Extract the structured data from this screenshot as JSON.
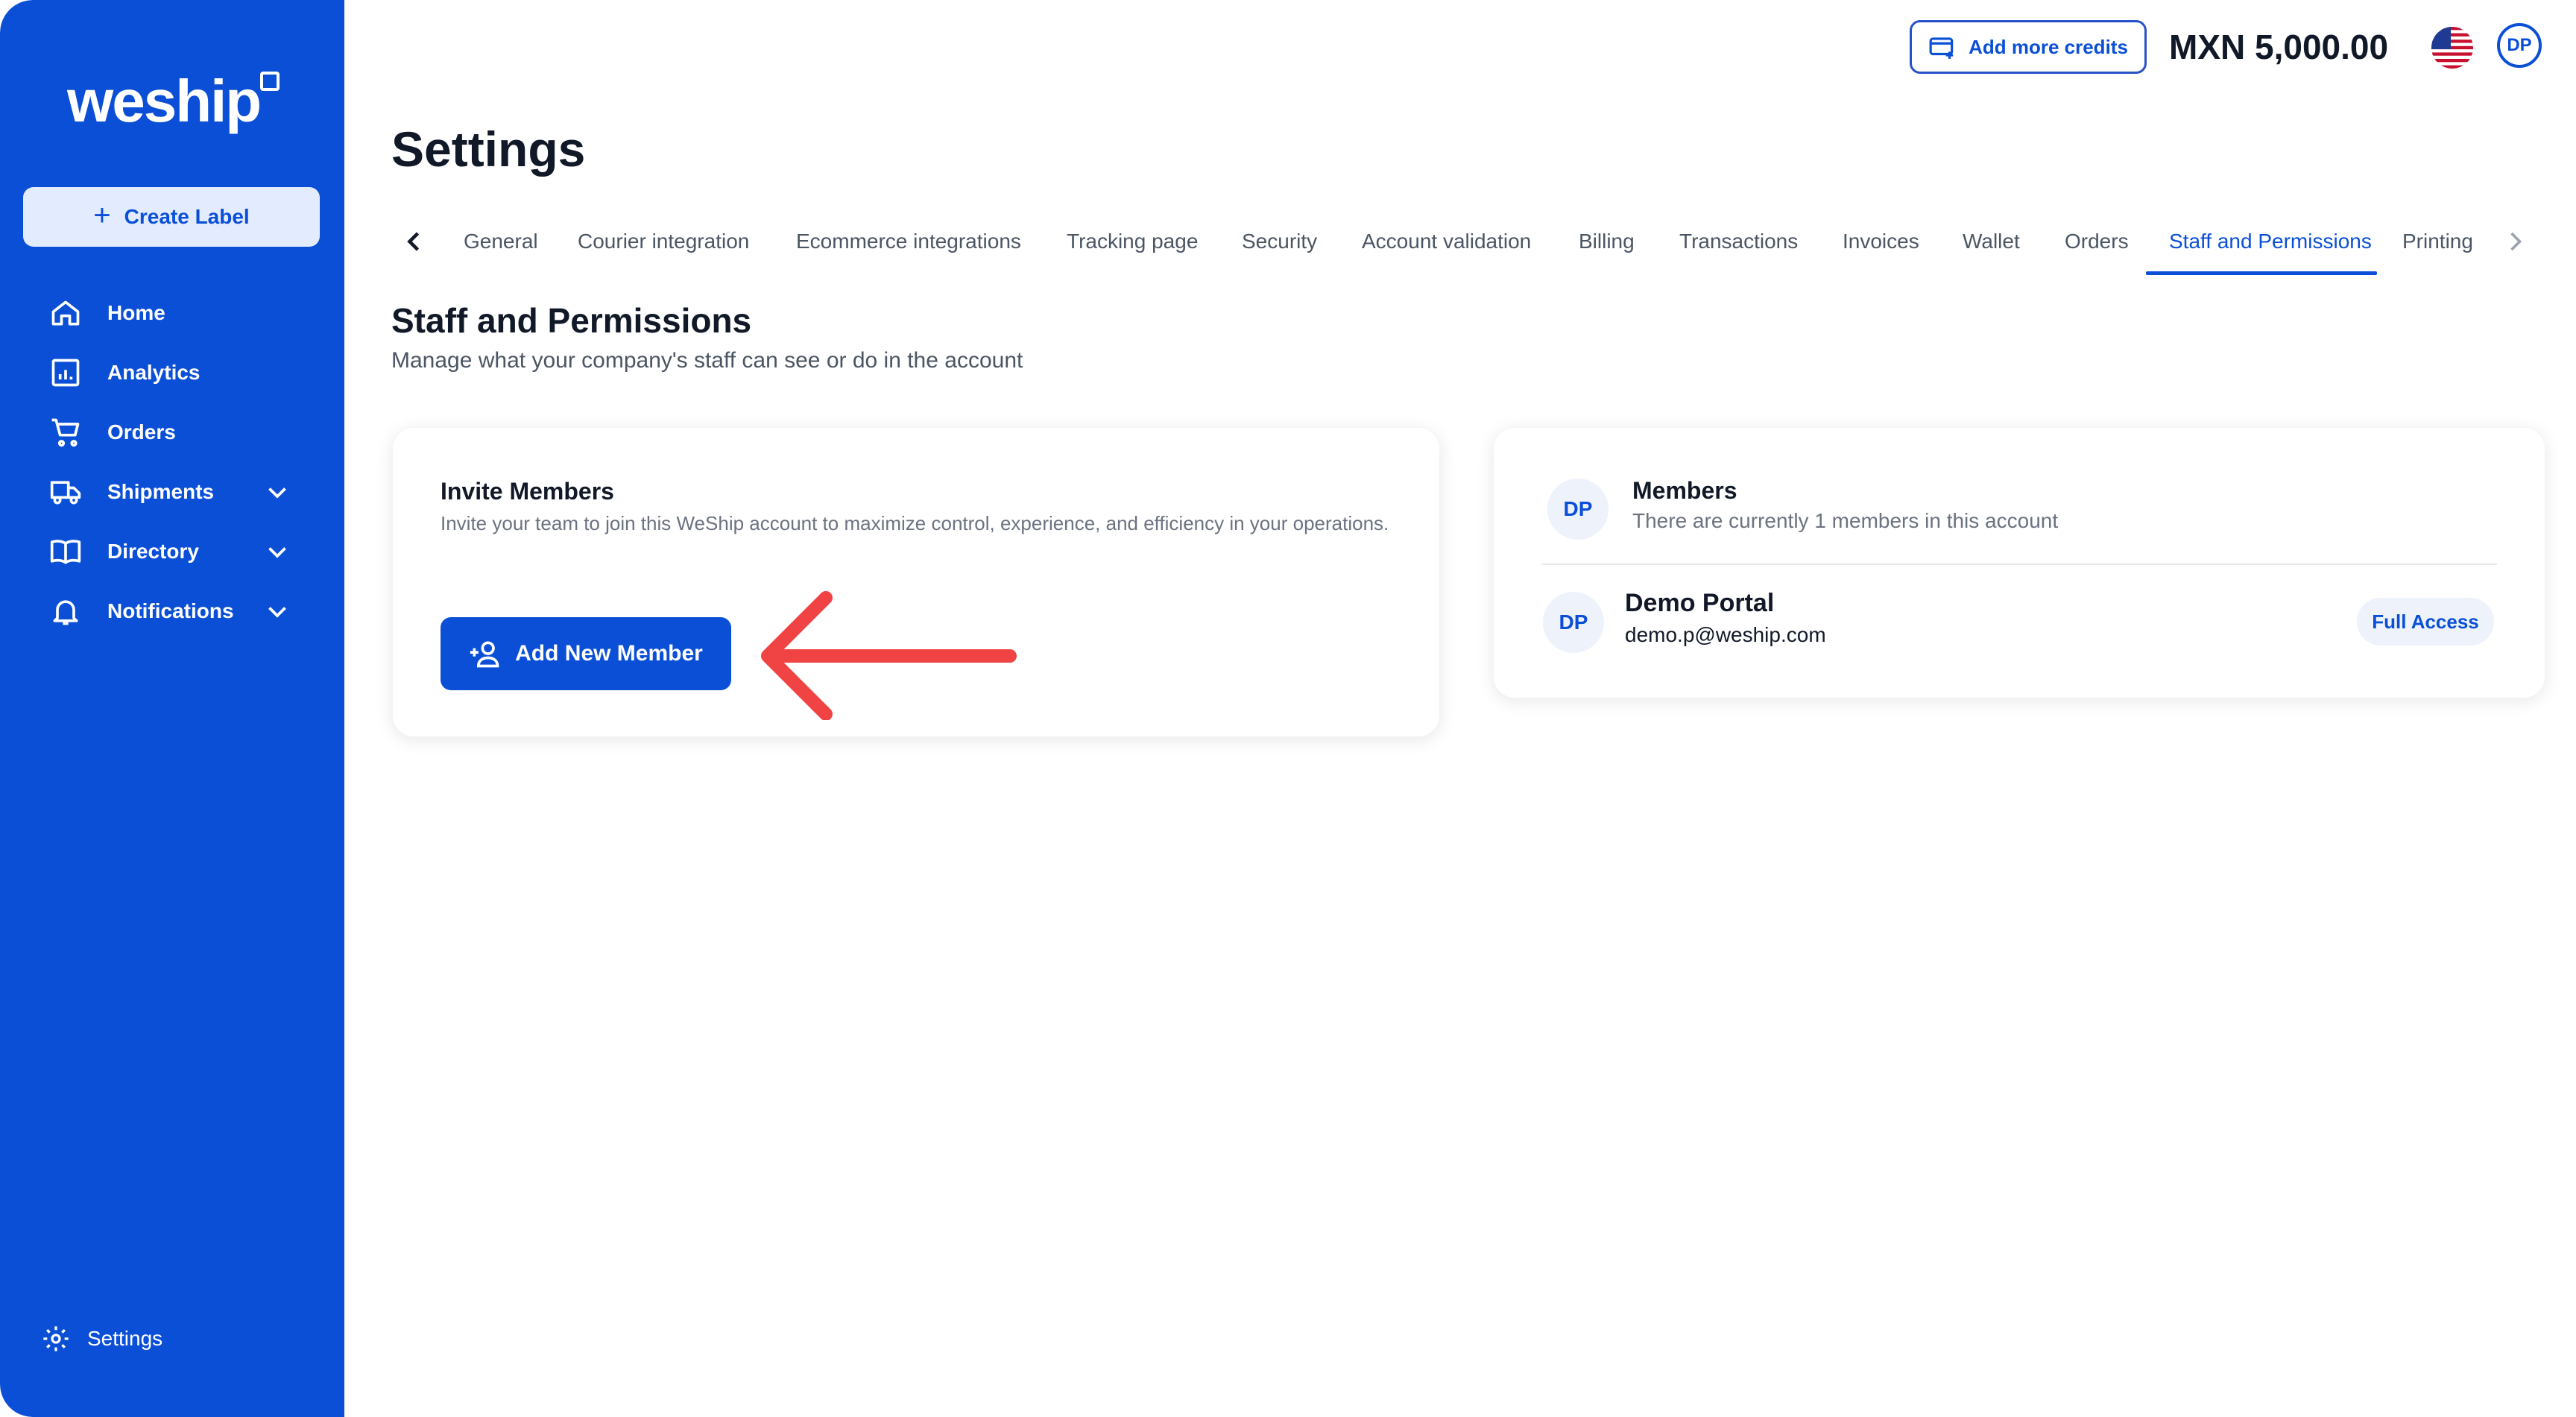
{
  "sidebar": {
    "logo": "weship",
    "create_label": "Create Label",
    "items": [
      {
        "label": "Home",
        "icon": "home-icon"
      },
      {
        "label": "Analytics",
        "icon": "analytics-icon"
      },
      {
        "label": "Orders",
        "icon": "cart-icon"
      },
      {
        "label": "Shipments",
        "icon": "truck-icon",
        "expandable": true
      },
      {
        "label": "Directory",
        "icon": "book-icon",
        "expandable": true
      },
      {
        "label": "Notifications",
        "icon": "bell-icon",
        "expandable": true
      }
    ],
    "settings_label": "Settings"
  },
  "topbar": {
    "credits_label": "Add more credits",
    "balance": "MXN 5,000.00",
    "avatar_initials": "DP",
    "flag": "us-flag-icon"
  },
  "page": {
    "title": "Settings"
  },
  "tabs": {
    "items": [
      "General",
      "Courier integration",
      "Ecommerce integrations",
      "Tracking page",
      "Security",
      "Account validation",
      "Billing",
      "Transactions",
      "Invoices",
      "Wallet",
      "Orders",
      "Staff and Permissions",
      "Printing"
    ],
    "active": "Staff and Permissions"
  },
  "section": {
    "title": "Staff and Permissions",
    "subtitle": "Manage what your company's staff can see or do in the account"
  },
  "invite": {
    "title": "Invite Members",
    "description": "Invite your team to join this WeShip account to maximize control, experience, and efficiency in your operations.",
    "button_label": "Add New Member"
  },
  "members": {
    "avatar_initials": "DP",
    "title": "Members",
    "subtitle": "There are currently 1 members in this account",
    "list": [
      {
        "initials": "DP",
        "name": "Demo Portal",
        "email": "demo.p@weship.com",
        "access": "Full Access"
      }
    ]
  },
  "colors": {
    "brand": "#0a4fd6",
    "annotation_arrow": "#f04444"
  }
}
